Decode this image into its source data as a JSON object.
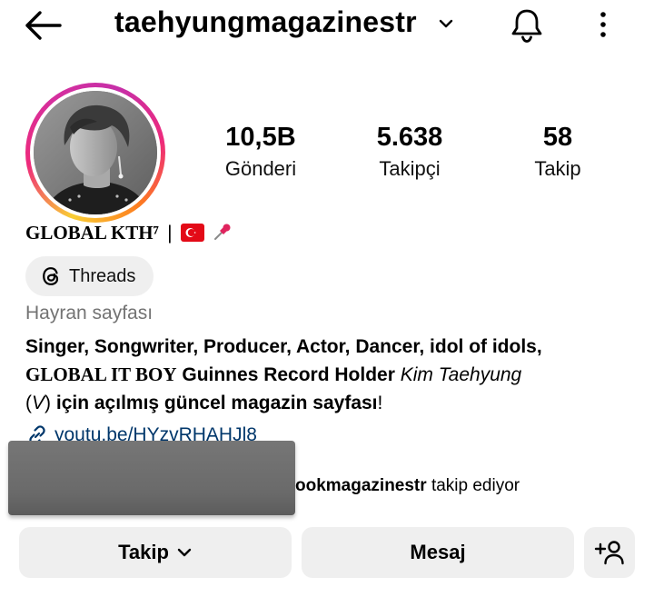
{
  "header": {
    "username": "taehyungmagazinestr",
    "icons": {
      "back": "arrow-left-icon",
      "account_switch": "chevron-down-icon",
      "notifications": "bell-icon",
      "more": "more-vertical-icon"
    }
  },
  "profile": {
    "stats": [
      {
        "value": "10,5B",
        "label": "Gönderi"
      },
      {
        "value": "5.638",
        "label": "Takipçi"
      },
      {
        "value": "58",
        "label": "Takip"
      }
    ],
    "display_name": "GLOBAL KTH⁷",
    "display_name_separator": "|",
    "threads_label": "Threads",
    "category": "Hayran sayfası",
    "bio": {
      "line1": "Singer, Songwriter, Producer, Actor, Dancer, idol of idols,",
      "line2_serif": "GLOBAL IT BOY",
      "line2_bold": "Guinnes Record Holder",
      "line2_italic": "Kim Taehyung",
      "line3_prefix": "(",
      "line3_italic": "V",
      "line3_suffix": ")",
      "line3_bold": "için açılmış güncel magazin sayfası",
      "line3_end": "!"
    },
    "link": "youtu.be/HYzvRHAHJl8",
    "followed_by": {
      "name_partial": "ookmagazinestr",
      "suffix": "takip ediyor"
    }
  },
  "actions": {
    "follow_label": "Takip",
    "message_label": "Mesaj",
    "add_person_icon": "person-add-icon"
  },
  "colors": {
    "link": "#00376b",
    "button_bg": "#efefef",
    "muted_text": "#737373"
  }
}
